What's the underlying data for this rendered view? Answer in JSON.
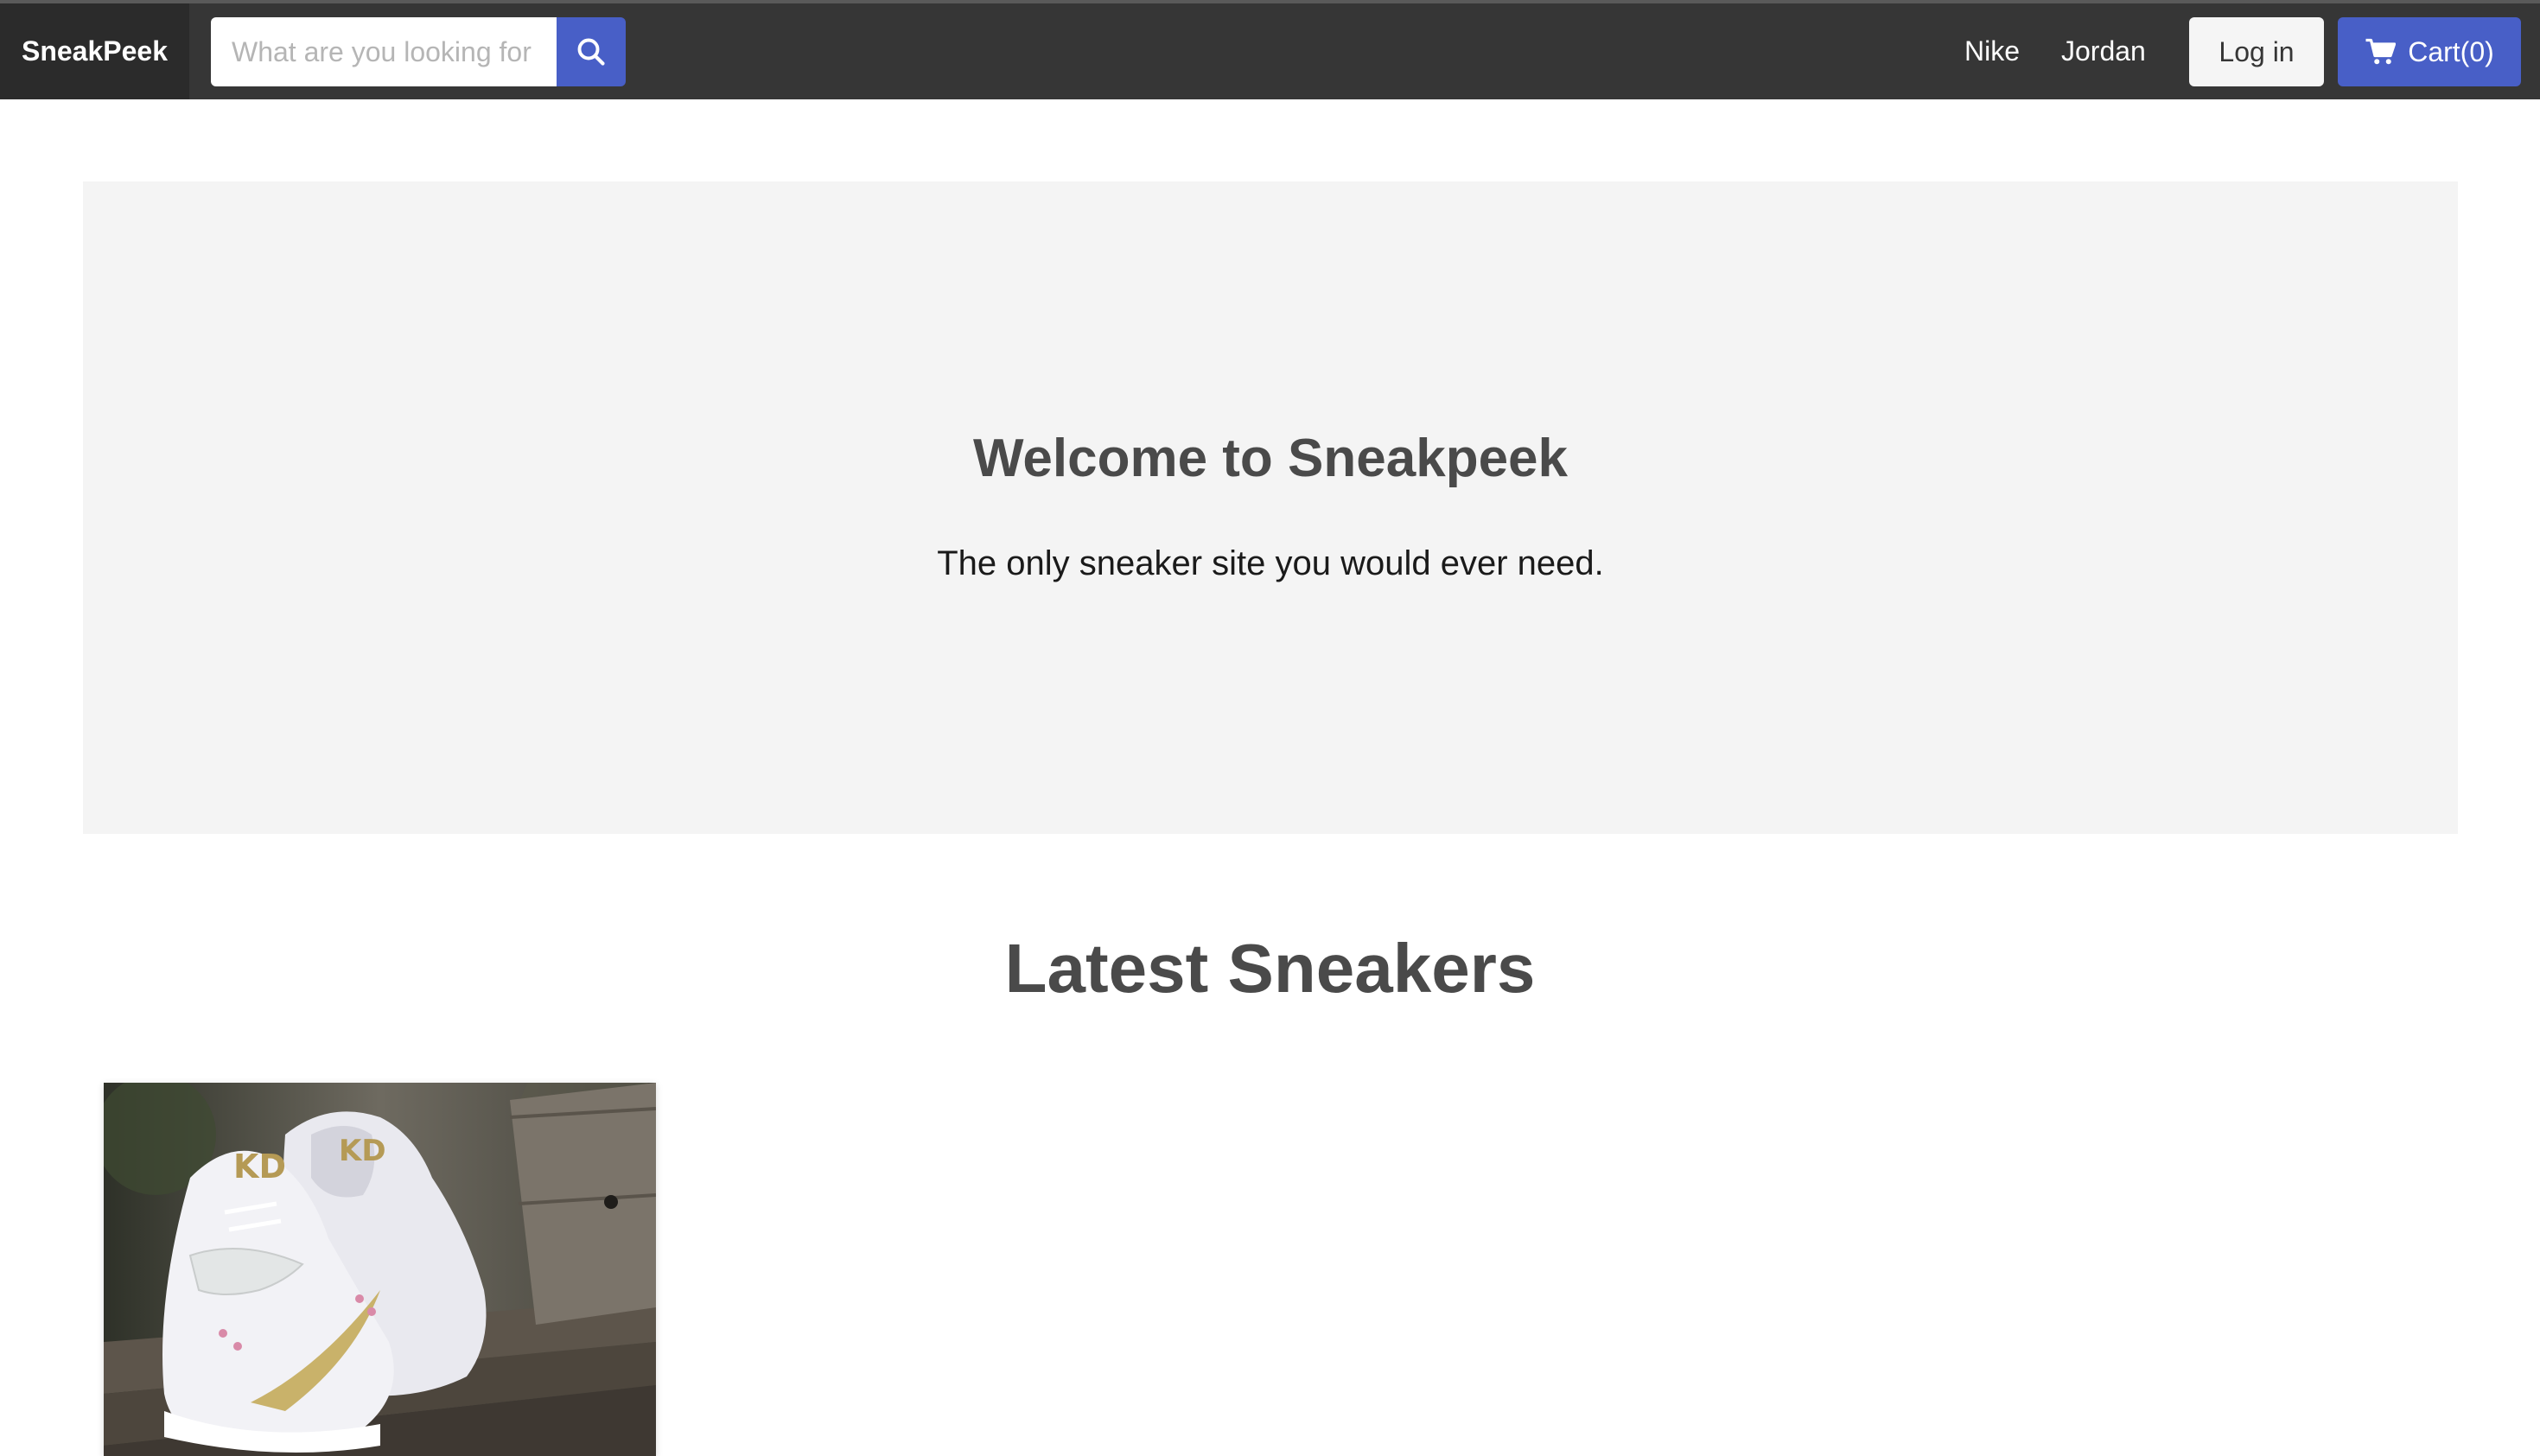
{
  "navbar": {
    "brand": "SneakPeek",
    "search": {
      "placeholder": "What are you looking for",
      "icon": "search-icon"
    },
    "links": [
      {
        "label": "Nike"
      },
      {
        "label": "Jordan"
      }
    ],
    "login_label": "Log in",
    "cart_label": "Cart(0)",
    "cart_icon": "cart-icon"
  },
  "hero": {
    "title": "Welcome to Sneakpeek",
    "subtitle": "The only sneaker site you would ever need."
  },
  "latest": {
    "title": "Latest Sneakers",
    "products": [
      {
        "image": "sneaker-photo"
      }
    ]
  },
  "colors": {
    "navbar_bg": "#363636",
    "brand_bg": "#2b2b2b",
    "primary": "#485fc7",
    "hero_bg": "#f4f4f4"
  }
}
